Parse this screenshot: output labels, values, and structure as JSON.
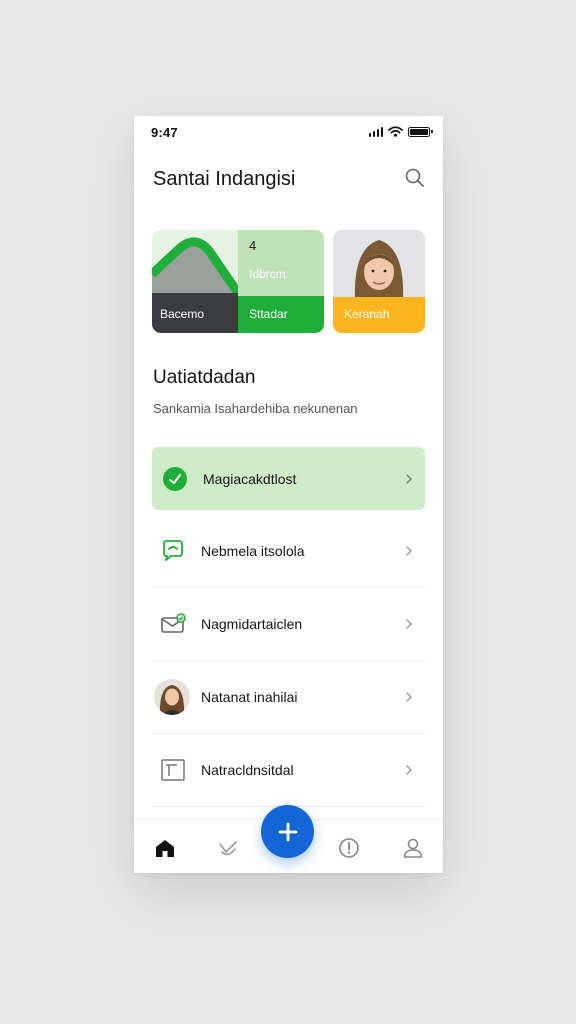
{
  "status_bar": {
    "time": "9:47"
  },
  "header": {
    "title": "Santai Indangisi"
  },
  "cards": {
    "wide": {
      "left_label": "Bacemo",
      "number": "4",
      "mid_label": "Idbrcm",
      "right_label": "Sttadar"
    },
    "photo": {
      "label": "Keranah"
    }
  },
  "section": {
    "title": "Uatiatdadan",
    "subtitle": "Sankamia Isahardehiba nekunenan"
  },
  "list": {
    "items": [
      {
        "label": "Magiacakdtlost",
        "icon": "check-circle-icon",
        "active": true
      },
      {
        "label": "Nebmela itsolola",
        "icon": "chat-bubble-icon"
      },
      {
        "label": "Nagmidartaiclen",
        "icon": "mail-icon"
      },
      {
        "label": "Natanat inahilai",
        "icon": "avatar"
      },
      {
        "label": "Natracldnsitdal",
        "icon": "frame-icon"
      }
    ]
  },
  "tabbar": {
    "tabs": [
      "home-icon",
      "heart-hand-icon",
      "add-icon",
      "alert-icon",
      "profile-icon"
    ]
  },
  "colors": {
    "accent_green": "#1fae3a",
    "light_green": "#cfecc8",
    "yellow": "#fbb61f",
    "fab_blue": "#1466d6"
  }
}
